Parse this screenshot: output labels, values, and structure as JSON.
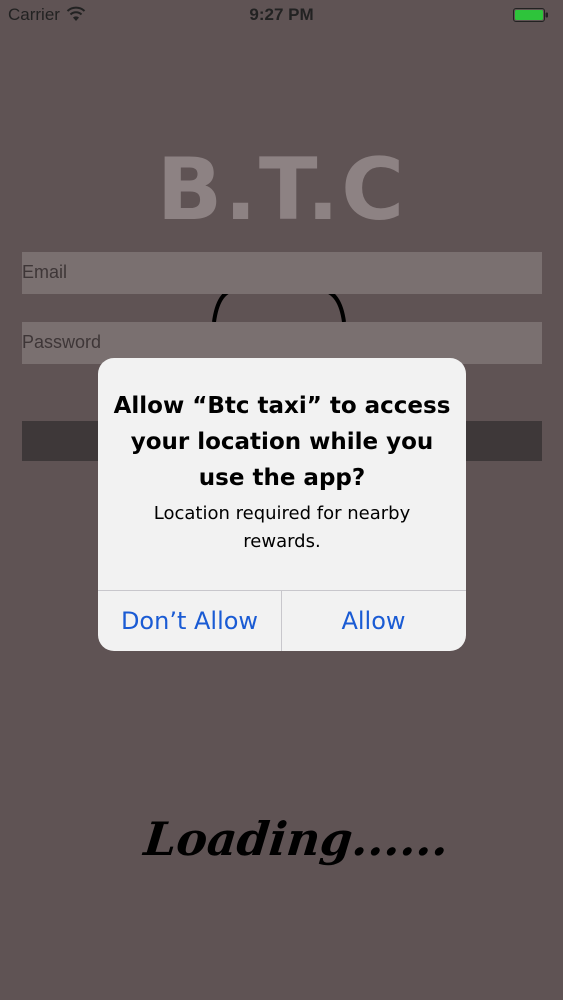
{
  "status_bar": {
    "carrier": "Carrier",
    "time": "9:27 PM",
    "wifi_icon": "wifi-icon",
    "battery_icon": "battery-icon",
    "battery_color": "#2ec43b"
  },
  "app": {
    "logo": "B.T.C",
    "email_placeholder": "Email",
    "password_placeholder": "Password",
    "loading": "Loading......"
  },
  "alert": {
    "title": "Allow “Btc taxi” to access your location while you use the app?",
    "message": "Location required for nearby rewards.",
    "dont_allow_label": "Don’t Allow",
    "allow_label": "Allow",
    "button_color": "#1a5bd4"
  },
  "colors": {
    "background": "#5f5354",
    "alert_background": "#f2f2f2"
  }
}
